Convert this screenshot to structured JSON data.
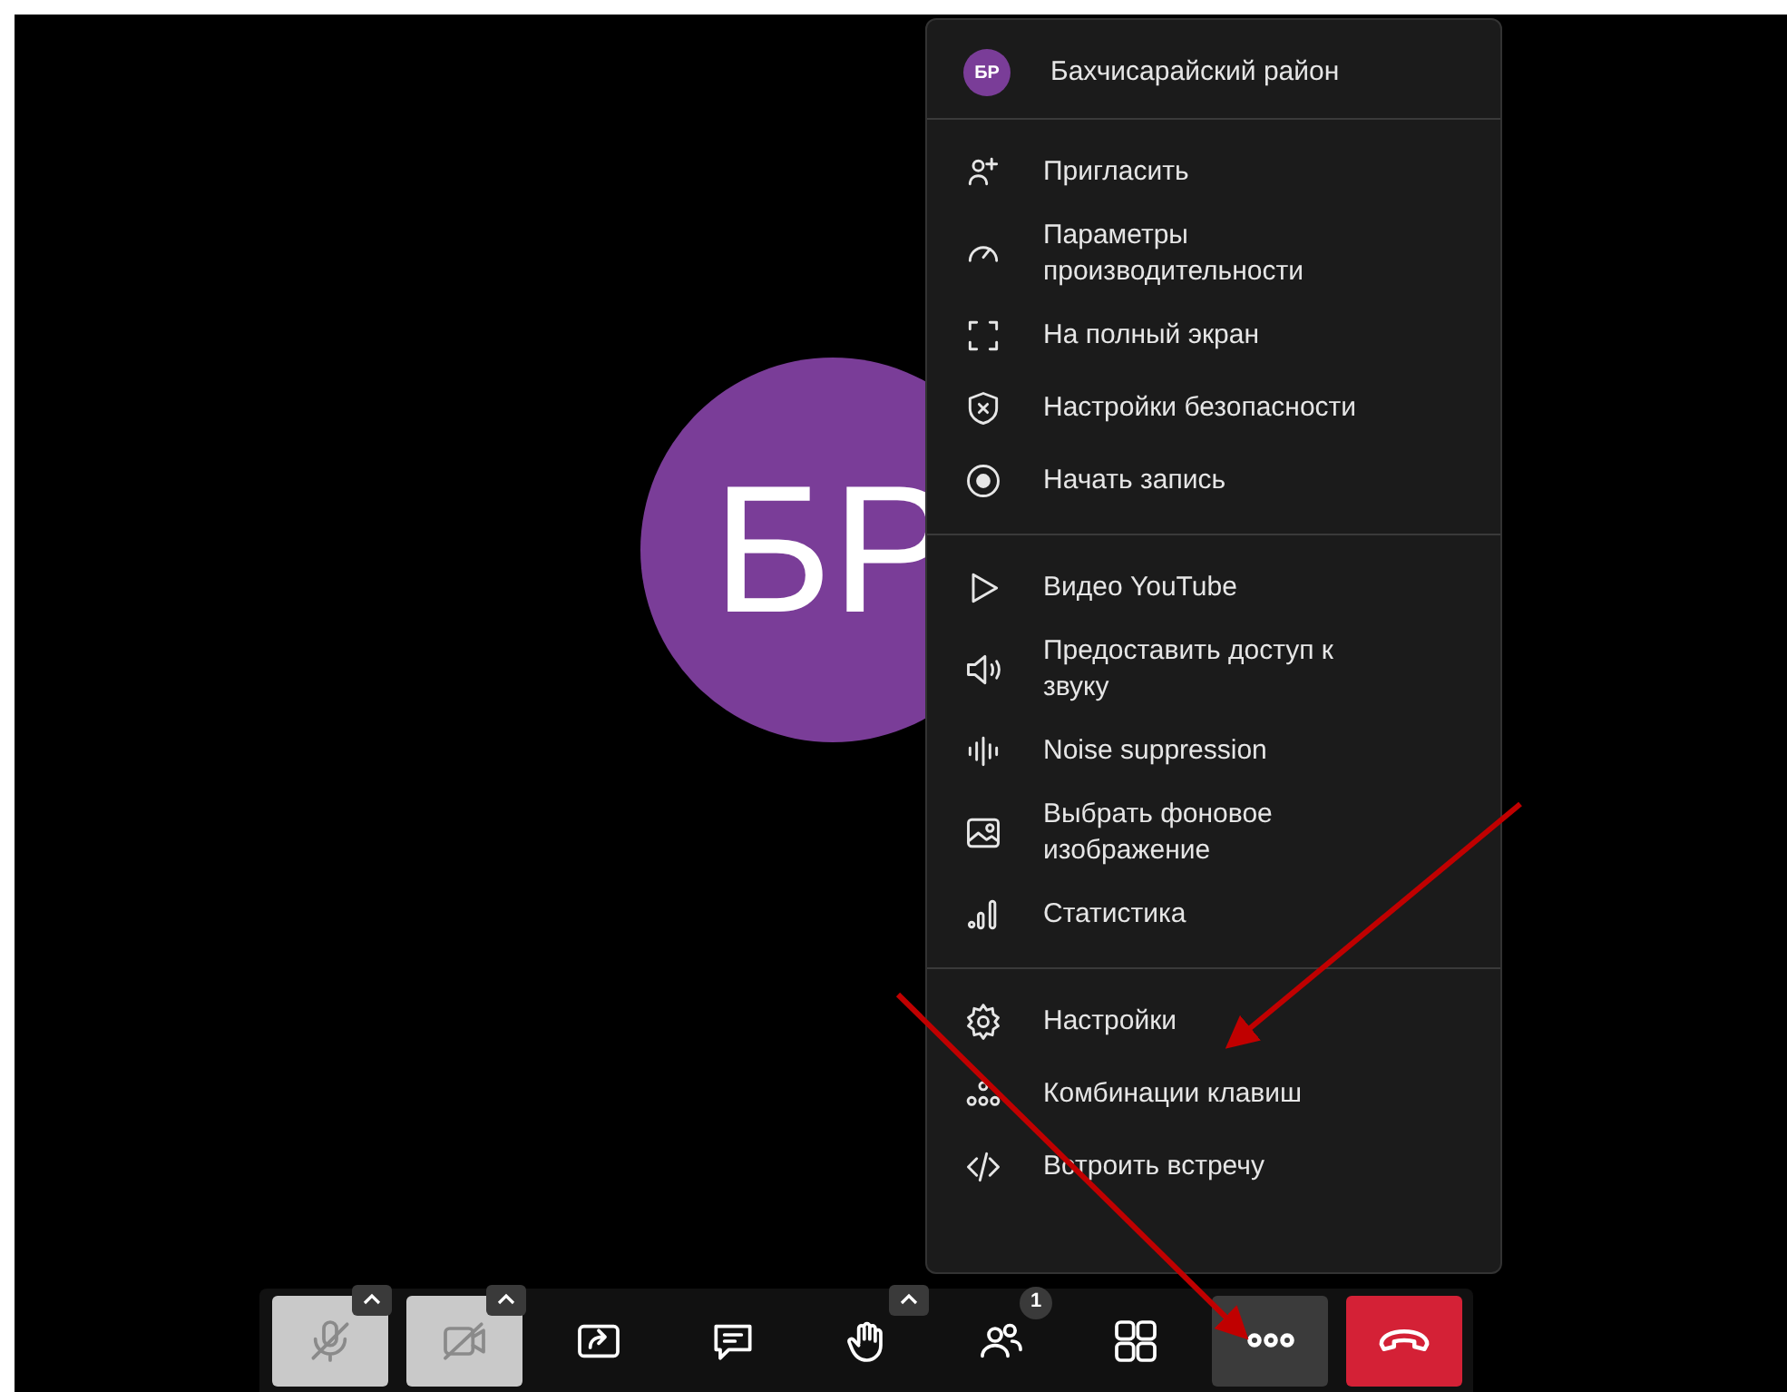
{
  "stage": {
    "avatar": {
      "initials": "БР"
    }
  },
  "menu": {
    "header": {
      "initials": "БР",
      "name": "Бахчисарайский район"
    },
    "sections": [
      [
        {
          "kind": "invite",
          "label": "Пригласить"
        },
        {
          "kind": "performance",
          "label": "Параметры производительности"
        },
        {
          "kind": "fullscreen",
          "label": "На полный экран"
        },
        {
          "kind": "security",
          "label": "Настройки безопасности"
        },
        {
          "kind": "record",
          "label": "Начать запись"
        }
      ],
      [
        {
          "kind": "video",
          "label": "Видео YouTube"
        },
        {
          "kind": "audio",
          "label": "Предоставить доступ к звуку"
        },
        {
          "kind": "noise",
          "label": "Noise suppression"
        },
        {
          "kind": "background",
          "label": "Выбрать фоновое изображение"
        },
        {
          "kind": "stats",
          "label": "Статистика"
        }
      ],
      [
        {
          "kind": "settings",
          "label": "Настройки"
        },
        {
          "kind": "shortcuts",
          "label": "Комбинации клавиш"
        },
        {
          "kind": "embed",
          "label": "Встроить встречу"
        }
      ]
    ]
  },
  "toolbar": [
    {
      "kind": "mic",
      "muted": true,
      "has_menu": true
    },
    {
      "kind": "camera",
      "muted": true,
      "has_menu": true
    },
    {
      "kind": "share"
    },
    {
      "kind": "chat"
    },
    {
      "kind": "hand",
      "has_menu": true
    },
    {
      "kind": "participants",
      "badge": "1"
    },
    {
      "kind": "tiles"
    },
    {
      "kind": "more",
      "active": true
    },
    {
      "kind": "hangup"
    }
  ]
}
